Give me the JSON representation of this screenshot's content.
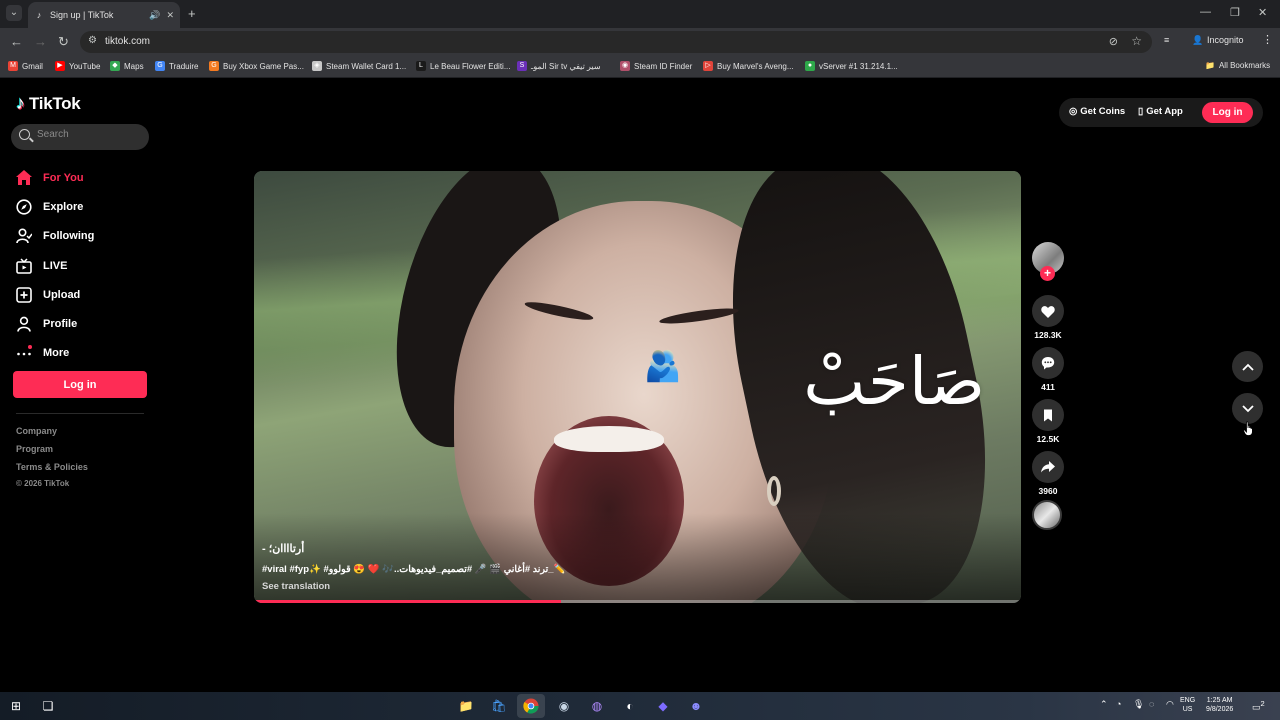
{
  "browser": {
    "tab_title": "Sign up | TikTok",
    "url": "tiktok.com",
    "incognito_label": "Incognito",
    "all_bookmarks_label": "All Bookmarks",
    "bookmarks": [
      {
        "label": "Gmail",
        "color": "#ea4335",
        "glyph": "M"
      },
      {
        "label": "YouTube",
        "color": "#ff0000",
        "glyph": "▶"
      },
      {
        "label": "Maps",
        "color": "#34a853",
        "glyph": "◆"
      },
      {
        "label": "Traduire",
        "color": "#4285f4",
        "glyph": "G"
      },
      {
        "label": "Buy Xbox Game Pas...",
        "color": "#f47a20",
        "glyph": "G"
      },
      {
        "label": "Steam Wallet Card 1...",
        "color": "#c8c8c8",
        "glyph": "◈"
      },
      {
        "label": "Le Beau Flower Editi...",
        "color": "#1a1a1a",
        "glyph": "L"
      },
      {
        "label": "الموـ Sir tv سير تيفي",
        "color": "#6a2fb8",
        "glyph": "S"
      },
      {
        "label": "Steam ID Finder",
        "color": "#b0506a",
        "glyph": "◉"
      },
      {
        "label": "Buy Marvel's Aveng...",
        "color": "#e0443a",
        "glyph": "▷"
      },
      {
        "label": "vServer #1 31.214.1...",
        "color": "#2ea84a",
        "glyph": "●"
      }
    ]
  },
  "tiktok": {
    "logo_text": "TikTok",
    "search_placeholder": "Search",
    "nav": [
      {
        "label": "For You",
        "icon": "home-icon",
        "active": true
      },
      {
        "label": "Explore",
        "icon": "compass-icon",
        "active": false
      },
      {
        "label": "Following",
        "icon": "following-icon",
        "active": false
      },
      {
        "label": "LIVE",
        "icon": "live-icon",
        "active": false
      },
      {
        "label": "Upload",
        "icon": "upload-icon",
        "active": false
      },
      {
        "label": "Profile",
        "icon": "profile-icon",
        "active": false
      },
      {
        "label": "More",
        "icon": "more-icon",
        "active": false
      }
    ],
    "login_label": "Log in",
    "footer_links": [
      "Company",
      "Program",
      "Terms & Policies"
    ],
    "copyright": "© 2026 TikTok",
    "top_right": {
      "coins_label": "Get Coins",
      "app_label": "Get App",
      "login_label": "Log in"
    },
    "video": {
      "overlay_text": "صَاحَبْ",
      "caption_user": "- أرتاااان؛",
      "caption_text": "#viral #fyp✨ #ترند #أغاني 🎬 🎤 #تصميم_فيديوهات..🎶 ❤️ 😍 قولوو_✏️",
      "see_translation": "See translation",
      "progress": 0.4
    },
    "actions": {
      "likes": "128.3K",
      "comments": "411",
      "saves": "12.5K",
      "shares": "3960"
    }
  },
  "colors": {
    "brand": "#fe2c55",
    "cyan": "#25f4ee"
  },
  "taskbar": {
    "lang": "ENG",
    "region": "US",
    "time": "1:25 AM",
    "date": "9/8/2026",
    "notif_count": "2"
  }
}
